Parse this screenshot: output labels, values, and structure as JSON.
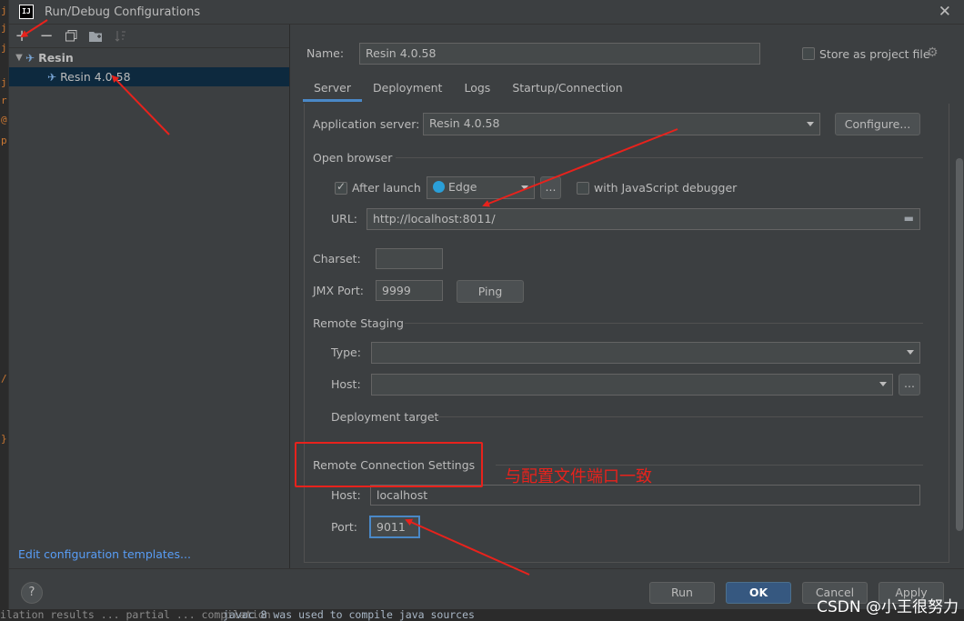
{
  "editor_strip": [
    "j",
    "j",
    "j",
    "j",
    "r",
    "@",
    "p",
    "/",
    "}"
  ],
  "window": {
    "title": "Run/Debug Configurations",
    "app_icon_label": "IJ"
  },
  "toolbar": [
    "add-icon",
    "remove-icon",
    "copy-icon",
    "folder-icon",
    "sort-icon"
  ],
  "tree": {
    "group": "Resin",
    "item": "Resin 4.0.58"
  },
  "edit_templates": "Edit configuration templates...",
  "name_row": {
    "label": "Name:",
    "value": "Resin 4.0.58",
    "store_label": "Store as project file"
  },
  "tabs": [
    "Server",
    "Deployment",
    "Logs",
    "Startup/Connection"
  ],
  "server": {
    "app_server_label": "Application server:",
    "app_server_value": "Resin 4.0.58",
    "configure_label": "Configure...",
    "open_browser_heading": "Open browser",
    "after_launch_label": "After launch",
    "after_launch_checked": true,
    "browser_value": "Edge",
    "browse_btn": "...",
    "js_debugger_label": "with JavaScript debugger",
    "url_label": "URL:",
    "url_value": "http://localhost:8011/",
    "charset_label": "Charset:",
    "charset_value": "",
    "jmx_label": "JMX Port:",
    "jmx_value": "9999",
    "ping_label": "Ping",
    "remote_staging_heading": "Remote Staging",
    "type_label": "Type:",
    "type_value": "",
    "host_label": "Host:",
    "host_value": "",
    "host_browse": "...",
    "deployment_target_label": "Deployment target",
    "remote_conn_heading": "Remote Connection Settings",
    "rc_host_label": "Host:",
    "rc_host_value": "localhost",
    "rc_port_label": "Port:",
    "rc_port_value": "9011"
  },
  "footer": {
    "help": "?",
    "run": "Run",
    "ok": "OK",
    "cancel": "Cancel",
    "apply": "Apply"
  },
  "bottom_strip": {
    "left": "ilation results ... partial ... compilation",
    "right": "javac 8 was used to compile java sources"
  },
  "annotation": {
    "note": "与配置文件端口一致",
    "color": "#e8221c"
  },
  "watermark": "CSDN @小王很努力"
}
